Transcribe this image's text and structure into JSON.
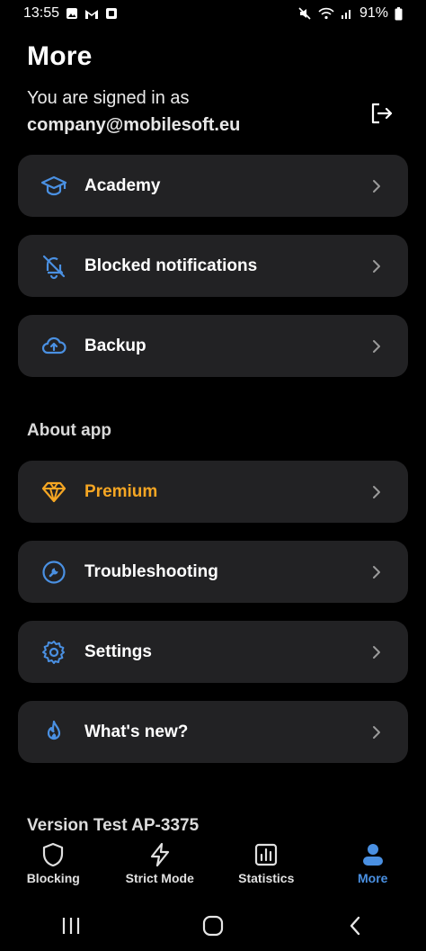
{
  "status_bar": {
    "time": "13:55",
    "battery": "91%"
  },
  "header": {
    "title": "More",
    "signed_in_label": "You are signed in as",
    "email": "company@mobilesoft.eu"
  },
  "menu": {
    "items": [
      {
        "label": "Academy",
        "icon": "graduation-cap-icon"
      },
      {
        "label": "Blocked notifications",
        "icon": "bell-off-icon"
      },
      {
        "label": "Backup",
        "icon": "cloud-upload-icon"
      }
    ]
  },
  "about": {
    "title": "About app",
    "items": [
      {
        "label": "Premium",
        "icon": "diamond-icon",
        "color": "#f5a623"
      },
      {
        "label": "Troubleshooting",
        "icon": "wrench-icon"
      },
      {
        "label": "Settings",
        "icon": "gear-icon"
      },
      {
        "label": "What's new?",
        "icon": "flame-icon"
      }
    ]
  },
  "version": "Version Test AP-3375",
  "bottom_nav": {
    "items": [
      {
        "label": "Blocking",
        "icon": "shield-icon"
      },
      {
        "label": "Strict Mode",
        "icon": "lightning-icon"
      },
      {
        "label": "Statistics",
        "icon": "bar-chart-icon"
      },
      {
        "label": "More",
        "icon": "person-icon",
        "active": true
      }
    ]
  },
  "colors": {
    "accent": "#4a90e2",
    "premium": "#f5a623",
    "card_bg": "#222224"
  }
}
